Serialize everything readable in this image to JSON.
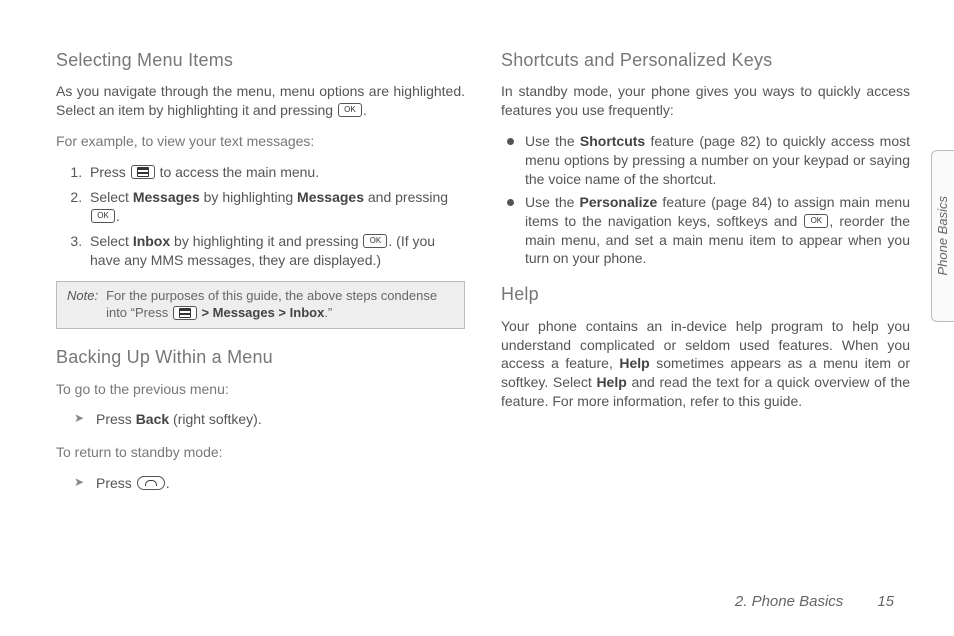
{
  "left": {
    "h1": "Selecting Menu Items",
    "p1a": "As you navigate through the menu, menu options are highlighted. Select an item by highlighting it and pressing ",
    "p1b": ".",
    "p2": "For example, to view your text messages:",
    "steps": {
      "s1a": "Press ",
      "s1b": " to access the main menu.",
      "s2a": "Select ",
      "s2b": "Messages",
      "s2c": " by highlighting ",
      "s2d": "Messages",
      "s2e": " and pressing ",
      "s2f": ".",
      "s3a": "Select ",
      "s3b": "Inbox",
      "s3c": " by highlighting it and pressing ",
      "s3d": ". (If you have any MMS messages, they are displayed.)"
    },
    "note_label": "Note:",
    "note_a": "For the purposes of this guide, the above steps condense into “Press ",
    "note_b": " > ",
    "note_c": "Messages",
    "note_d": " > ",
    "note_e": "Inbox",
    "note_f": ".”",
    "h2": "Backing Up Within a Menu",
    "p3": "To go to the previous menu:",
    "back_a": "Press ",
    "back_b": "Back",
    "back_c": " (right softkey).",
    "p4": "To return to standby mode:",
    "end_a": "Press ",
    "end_b": "."
  },
  "right": {
    "h1": "Shortcuts and Personalized Keys",
    "p1": "In standby mode, your phone gives you ways to quickly access features you use frequently:",
    "b1a": "Use the ",
    "b1b": "Shortcuts",
    "b1c": " feature (page 82) to quickly access most menu options by pressing a number on your keypad or saying the voice name of the shortcut.",
    "b2a": "Use the ",
    "b2b": "Personalize",
    "b2c": " feature (page 84) to assign main menu items to the navigation keys, softkeys and ",
    "b2d": ", reorder the main menu, and set a main menu item to appear when you turn on your phone.",
    "h2": "Help",
    "p2a": "Your phone contains an in-device help program to help you understand complicated or seldom used features. When you access a feature, ",
    "p2b": "Help",
    "p2c": " sometimes appears as a menu item or softkey. Select ",
    "p2d": "Help",
    "p2e": " and read the text for a quick overview of the feature. For more information, refer to this guide."
  },
  "key_ok": "OK",
  "footer_section": "2. Phone Basics",
  "footer_page": "15",
  "sidetab": "Phone Basics"
}
